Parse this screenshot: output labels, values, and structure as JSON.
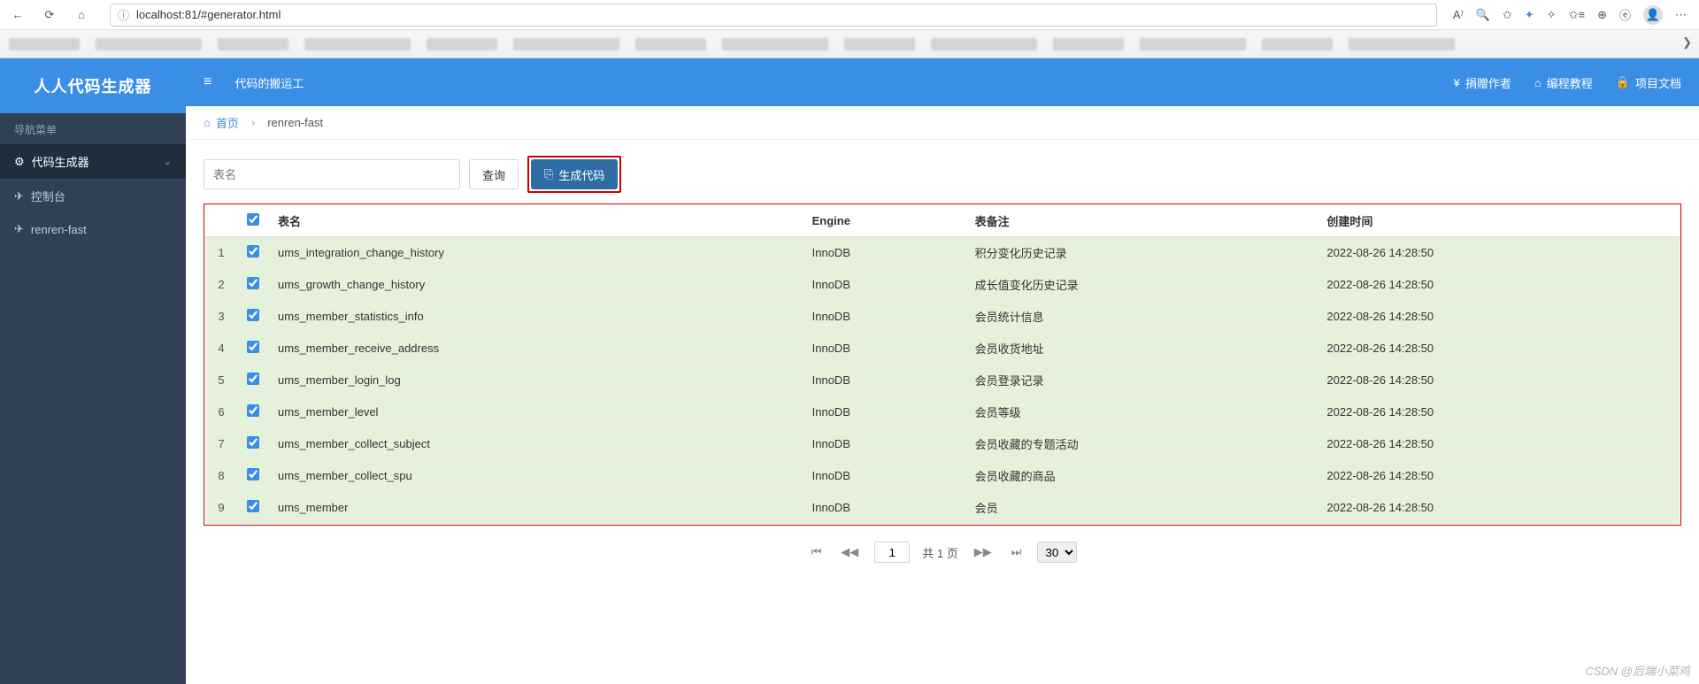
{
  "browser": {
    "url": "localhost:81/#generator.html"
  },
  "brand": "人人代码生成器",
  "sidebar": {
    "menu_title": "导航菜单",
    "items": [
      {
        "icon": "gear-icon",
        "label": "代码生成器",
        "expandable": true,
        "active": true
      },
      {
        "icon": "plane-icon",
        "label": "控制台",
        "expandable": false,
        "active": false
      },
      {
        "icon": "plane-icon",
        "label": "renren-fast",
        "expandable": false,
        "active": false
      }
    ]
  },
  "topbar": {
    "slogan": "代码的搬运工",
    "right": [
      {
        "icon": "yen-icon",
        "label": "捐赠作者"
      },
      {
        "icon": "home-icon",
        "label": "编程教程"
      },
      {
        "icon": "lock-icon",
        "label": "项目文档"
      }
    ]
  },
  "crumb": {
    "home": "首页",
    "current": "renren-fast"
  },
  "toolbar": {
    "search_placeholder": "表名",
    "search_label": "查询",
    "generate_label": "生成代码"
  },
  "table": {
    "headers": {
      "name": "表名",
      "engine": "Engine",
      "comment": "表备注",
      "created": "创建时间"
    },
    "rows": [
      {
        "idx": "1",
        "name": "ums_integration_change_history",
        "engine": "InnoDB",
        "comment": "积分变化历史记录",
        "created": "2022-08-26 14:28:50"
      },
      {
        "idx": "2",
        "name": "ums_growth_change_history",
        "engine": "InnoDB",
        "comment": "成长值变化历史记录",
        "created": "2022-08-26 14:28:50"
      },
      {
        "idx": "3",
        "name": "ums_member_statistics_info",
        "engine": "InnoDB",
        "comment": "会员统计信息",
        "created": "2022-08-26 14:28:50"
      },
      {
        "idx": "4",
        "name": "ums_member_receive_address",
        "engine": "InnoDB",
        "comment": "会员收货地址",
        "created": "2022-08-26 14:28:50"
      },
      {
        "idx": "5",
        "name": "ums_member_login_log",
        "engine": "InnoDB",
        "comment": "会员登录记录",
        "created": "2022-08-26 14:28:50"
      },
      {
        "idx": "6",
        "name": "ums_member_level",
        "engine": "InnoDB",
        "comment": "会员等级",
        "created": "2022-08-26 14:28:50"
      },
      {
        "idx": "7",
        "name": "ums_member_collect_subject",
        "engine": "InnoDB",
        "comment": "会员收藏的专题活动",
        "created": "2022-08-26 14:28:50"
      },
      {
        "idx": "8",
        "name": "ums_member_collect_spu",
        "engine": "InnoDB",
        "comment": "会员收藏的商品",
        "created": "2022-08-26 14:28:50"
      },
      {
        "idx": "9",
        "name": "ums_member",
        "engine": "InnoDB",
        "comment": "会员",
        "created": "2022-08-26 14:28:50"
      }
    ]
  },
  "pager": {
    "page": "1",
    "total_label": "共 1 页",
    "page_size": "30"
  },
  "watermark": "CSDN @后端小菜鸡"
}
